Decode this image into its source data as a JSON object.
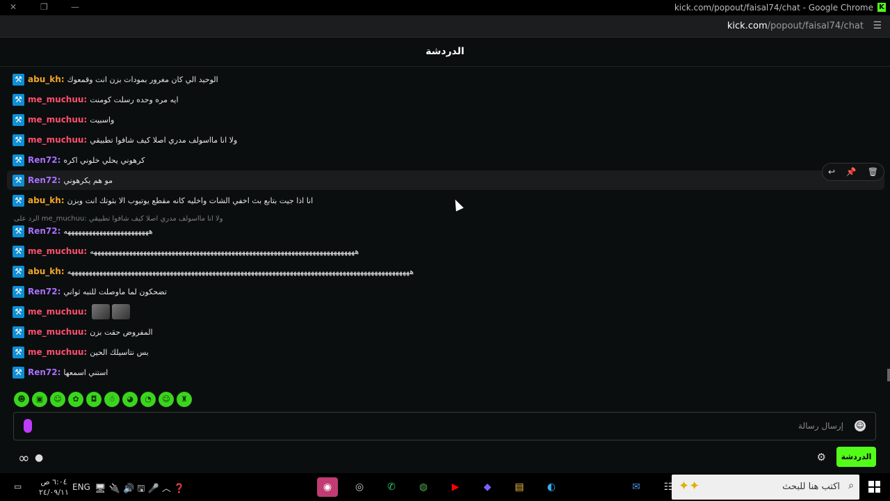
{
  "window": {
    "title": "kick.com/popout/faisal74/chat - Google Chrome",
    "url_domain": "kick.com",
    "url_path": "/popout/faisal74/chat",
    "brand_color": "#53fc18"
  },
  "chat": {
    "header": "الدردشة",
    "messages": [
      {
        "user": "abu_kh",
        "color": "#f5a623",
        "text": "الوحيد الي كان مغرور بمودات بزن انت وقمعوك"
      },
      {
        "user": "me_muchuu",
        "color": "#ff4f6d",
        "text": "ايه مره وحده رسلت كومنت"
      },
      {
        "user": "me_muchuu",
        "color": "#ff4f6d",
        "text": "واسبيت"
      },
      {
        "user": "me_muchuu",
        "color": "#ff4f6d",
        "text": "ولا انا مااسولف مدري اصلا كيف شافوا تطبيقي"
      },
      {
        "user": "Ren72",
        "color": "#a970ff",
        "text": "كرهوني يحلي خلوني اكره"
      },
      {
        "user": "Ren72",
        "color": "#a970ff",
        "text": "مو هم يكرهوني"
      },
      {
        "user": "abu_kh",
        "color": "#f5a623",
        "text": "انا اذا جيت بتابع بث اخفي الشات واخليه كانه مقطع يوتيوب الا بثوتك انت وبزن"
      },
      {
        "user": "Ren72",
        "color": "#a970ff",
        "text": "ههههههههههههههههههههههههه"
      },
      {
        "user": "me_muchuu",
        "color": "#ff4f6d",
        "text": "هههههههههههههههههههههههههههههههههههههههههههههههههههههههههههههههههههههههههههه"
      },
      {
        "user": "abu_kh",
        "color": "#f5a623",
        "text": "هههههههههههههههههههههههههههههههههههههههههههههههههههههههههههههههههههههههههههههههههههههههههههههههههه"
      },
      {
        "user": "Ren72",
        "color": "#a970ff",
        "text": "تضحكون لما ماوصلت للنبه ثواني"
      },
      {
        "user": "me_muchuu",
        "color": "#ff4f6d",
        "text": ""
      },
      {
        "user": "me_muchuu",
        "color": "#ff4f6d",
        "text": "المفروض حقت بزن"
      },
      {
        "user": "me_muchuu",
        "color": "#ff4f6d",
        "text": "بس نتاسيلك الحين"
      },
      {
        "user": "Ren72",
        "color": "#a970ff",
        "text": "استني اسمعها"
      }
    ],
    "reply_context": "الرد على me_muchuu: ولا انا مااسولف مدري اصلا كيف شافوا تطبيقي",
    "input_placeholder": "إرسال رسالة",
    "send_button": "الدردشة"
  },
  "taskbar": {
    "search_placeholder": "اكتب هنا للبحث",
    "lang": "ENG",
    "time": "٦:٠٤ ص",
    "date": "٢٤/٠٩/١١"
  }
}
